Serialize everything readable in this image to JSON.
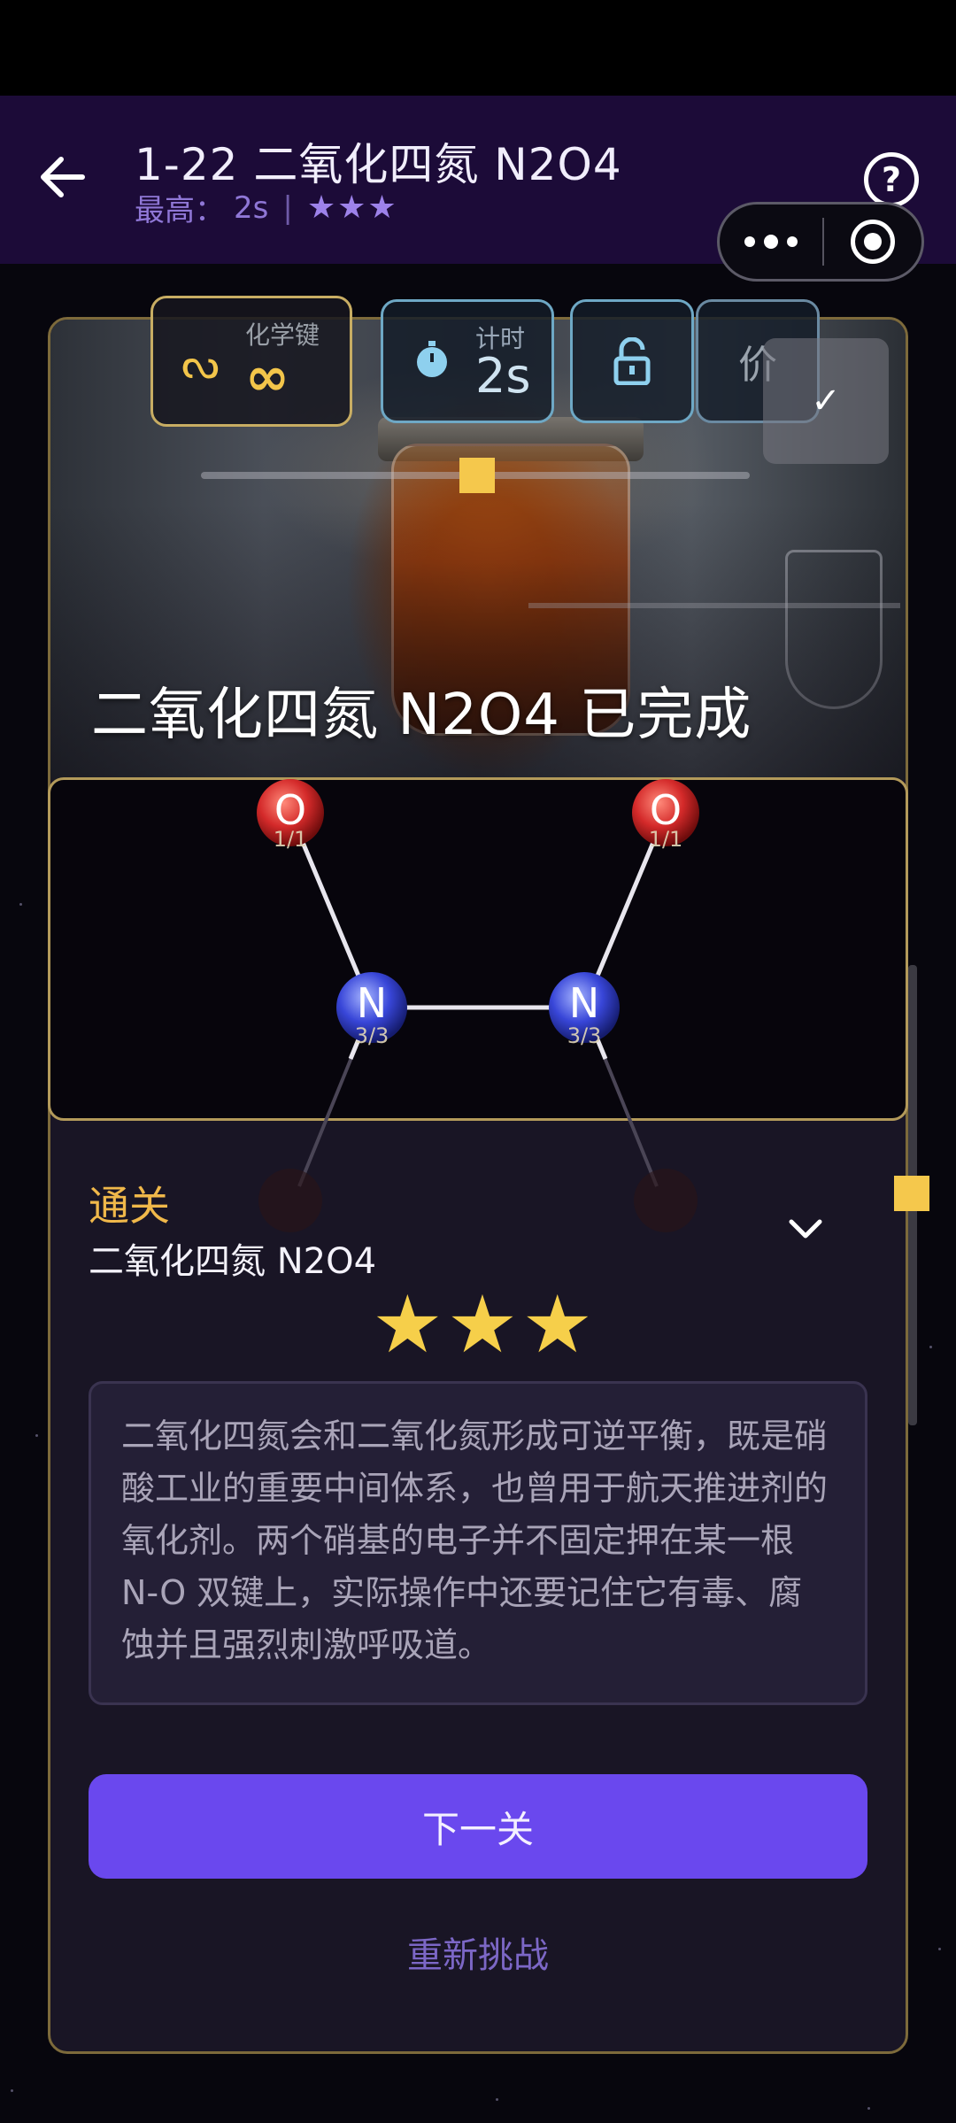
{
  "header": {
    "title": "1-22 二氧化四氮 N2O4",
    "best_label": "最高：",
    "best_time": "2s",
    "best_stars": "★★★"
  },
  "hud": {
    "bonds_label": "化学键",
    "bonds_value": "∞",
    "timer_label": "计时",
    "timer_value": "2s",
    "valence_label": "价"
  },
  "photo": {
    "completed_text": "二氧化四氮 N2O4 已完成"
  },
  "molecule": {
    "atoms": [
      {
        "symbol": "O",
        "count": "1/1"
      },
      {
        "symbol": "O",
        "count": "1/1"
      },
      {
        "symbol": "N",
        "count": "3/3"
      },
      {
        "symbol": "N",
        "count": "3/3"
      }
    ]
  },
  "result": {
    "pass_label": "通关",
    "molecule_name": "二氧化四氮 N2O4",
    "stars": "★★★",
    "description": "二氧化四氮会和二氧化氮形成可逆平衡，既是硝酸工业的重要中间体系，也曾用于航天推进剂的氧化剂。两个硝基的电子并不固定押在某一根 N-O 双键上，实际操作中还要记住它有毒、腐蚀并且强烈刺激呼吸道。",
    "next_button": "下一关",
    "retry_link": "重新挑战"
  },
  "colors": {
    "header_bg": "#1c0b38",
    "accent": "#6a48ee",
    "gold": "#f6cf4a",
    "oxygen": "#d42a2a",
    "nitrogen": "#3846d8"
  }
}
